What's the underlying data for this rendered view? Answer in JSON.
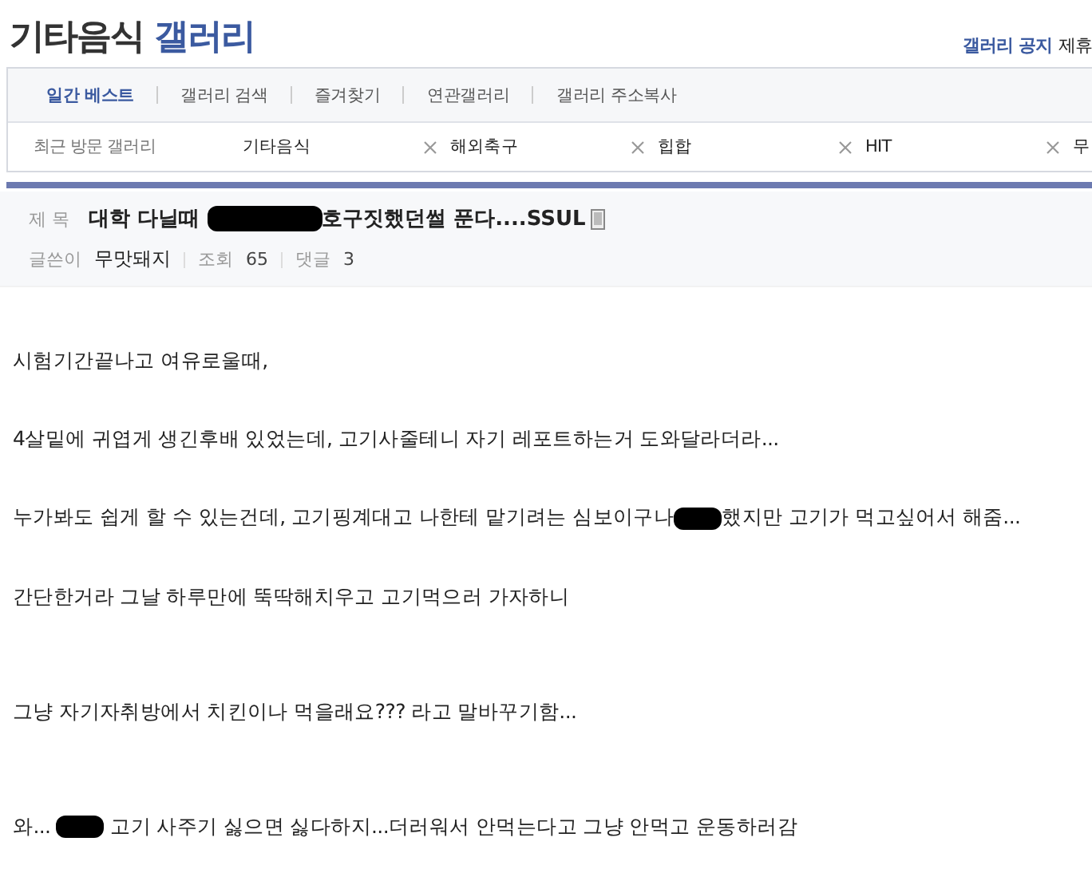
{
  "gallery_title": {
    "prefix": "기타음식",
    "name": "갤러리"
  },
  "top_links": [
    {
      "label": "갤러리 공지",
      "kind": "accent"
    },
    {
      "label": "제휴",
      "kind": "plain"
    }
  ],
  "tabs": [
    {
      "label": "일간 베스트",
      "selected": true
    },
    {
      "label": "갤러리 검색",
      "selected": false
    },
    {
      "label": "즐겨찾기",
      "selected": false
    },
    {
      "label": "연관갤러리",
      "selected": false
    },
    {
      "label": "갤러리 주소복사",
      "selected": false
    }
  ],
  "recent": {
    "label": "최근 방문 갤러리",
    "items": [
      {
        "label": "기타음식",
        "closable": true
      },
      {
        "label": "해외축구",
        "closable": true
      },
      {
        "label": "힙합",
        "closable": true
      },
      {
        "label": "HIT",
        "closable": true
      },
      {
        "label": "무"
      }
    ]
  },
  "post": {
    "subject_label": "제 목",
    "title": [
      {
        "kind": "text",
        "text": "대학 다닐때 "
      },
      {
        "kind": "redaction"
      },
      {
        "kind": "text",
        "text": "호구짓했던썰 푼다....SSUL"
      }
    ],
    "has_image": true,
    "author_label": "글쓴이",
    "author": "무맛돼지",
    "views_label": "조회",
    "views": "65",
    "comments_label": "댓글",
    "comments": "3"
  },
  "body": [
    [
      {
        "kind": "text",
        "text": "시험기간끝나고 여유로울때,"
      }
    ],
    [
      {
        "kind": "text",
        "text": "4살밑에 귀엽게 생긴후배 있었는데, 고기사줄테니 자기 레포트하는거 도와달라더라..."
      }
    ],
    [
      {
        "kind": "text",
        "text": "누가봐도 쉽게 할 수 있는건데, 고기핑계대고 나한테 맡기려는 심보이구나"
      },
      {
        "kind": "redaction"
      },
      {
        "kind": "text",
        "text": "했지만 고기가 먹고싶어서 해줌..."
      }
    ],
    [
      {
        "kind": "text",
        "text": "간단한거라 그날 하루만에 뚝딱해치우고 고기먹으러 가자하니"
      }
    ],
    [
      {
        "kind": "text",
        "text": "그냥 자기자취방에서 치킨이나 먹을래요??? 라고 말바꾸기함..."
      }
    ],
    [
      {
        "kind": "text",
        "text": "와... "
      },
      {
        "kind": "redaction"
      },
      {
        "kind": "text",
        "text": " 고기 사주기 싫으면 싫다하지...더러워서 안먹는다고 그냥 안먹고 운동하러감"
      }
    ]
  ]
}
